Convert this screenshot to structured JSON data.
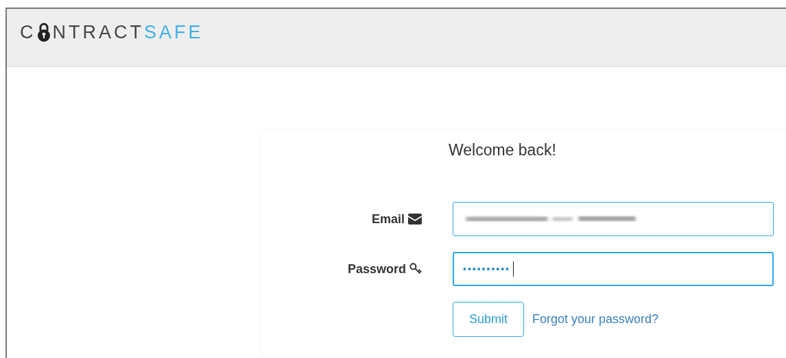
{
  "logo": {
    "lead": "C",
    "rest": "NTRACT",
    "accent": "SAFE"
  },
  "heading": "Welcome back!",
  "fields": [
    {
      "kind": "email",
      "label": "Email",
      "redacted": true,
      "focused": false
    },
    {
      "kind": "password",
      "label": "Password",
      "value": "••••••••••",
      "focused": true
    }
  ],
  "submit": "Submit",
  "forgot_link": "Forgot your password?"
}
